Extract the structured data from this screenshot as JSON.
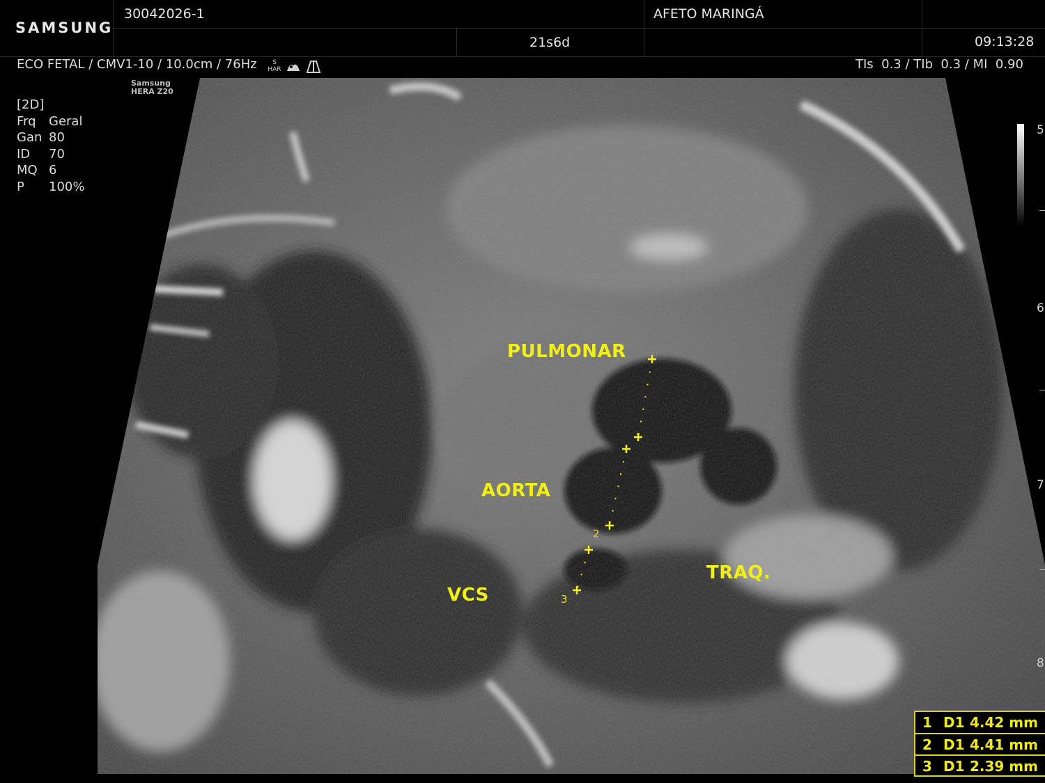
{
  "header": {
    "brand": "SAMSUNG",
    "patient_id": "30042026-1",
    "institution": "AFETO MARINGÁ",
    "gestational_age": "21s6d",
    "time": "09:13:28"
  },
  "scan_info": {
    "preset": "ECO FETAL / CMV1-10 / 10.0cm / 76Hz",
    "har_top": "S",
    "har_bottom": "HAR",
    "thermal": "TIs  0.3 / TIb  0.3 / MI  0.90"
  },
  "model": {
    "line1": "Samsung",
    "line2": "HERA Z20"
  },
  "params": {
    "mode": "[2D]",
    "rows": [
      {
        "key": "Frq",
        "value": "Geral"
      },
      {
        "key": "Gan",
        "value": "80"
      },
      {
        "key": "ID",
        "value": "70"
      },
      {
        "key": "MQ",
        "value": "6"
      },
      {
        "key": "P",
        "value": "100%"
      }
    ]
  },
  "annotations": {
    "pulmonar": "PULMONAR",
    "aorta": "AORTA",
    "vcs": "VCS",
    "traq": "TRAQ."
  },
  "calipers": {
    "n2": "2",
    "n3": "3"
  },
  "depth_marks": [
    "5",
    "6",
    "7",
    "8"
  ],
  "measurements": [
    {
      "n": "1",
      "label": "D1",
      "value": "4.42 mm"
    },
    {
      "n": "2",
      "label": "D1",
      "value": "4.41 mm"
    },
    {
      "n": "3",
      "label": "D1",
      "value": "2.39 mm"
    }
  ],
  "colors": {
    "annotation": "#f2ee1c",
    "caliper": "#f4ee1c"
  }
}
